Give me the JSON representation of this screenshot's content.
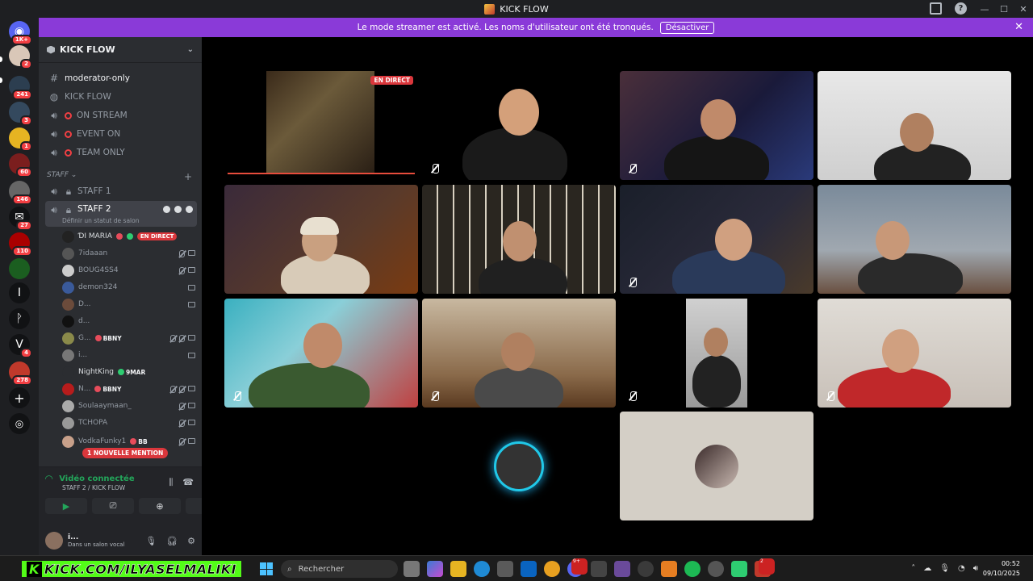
{
  "window": {
    "title": "KICK FLOW"
  },
  "banner": {
    "text": "Le mode streamer est activé. Les noms d'utilisateur ont été tronqués.",
    "button": "Désactiver"
  },
  "rail": {
    "badges": [
      "1K+",
      "2",
      "241",
      "3",
      "1",
      "60",
      "146",
      "27",
      "110",
      "4",
      "278"
    ],
    "glyphs": [
      "I",
      "ᚹ",
      "V"
    ]
  },
  "server": {
    "name": "KICK FLOW"
  },
  "channels": [
    {
      "name": "moderator-only"
    },
    {
      "name": "KICK FLOW"
    },
    {
      "name": "ON STREAM"
    },
    {
      "name": "EVENT ON"
    },
    {
      "name": "TEAM ONLY"
    }
  ],
  "category": {
    "name": "STAFF"
  },
  "voice_channels": [
    {
      "name": "STAFF 1"
    },
    {
      "name": "STAFF 2",
      "status_placeholder": "Définir un statut de salon"
    }
  ],
  "members": [
    {
      "name": "ƊI MARIA",
      "tag": "",
      "live": "EN DIRECT"
    },
    {
      "name": "7idaaan",
      "tag": ""
    },
    {
      "name": "BOUG4SS4",
      "tag": ""
    },
    {
      "name": "demon324",
      "tag": ""
    },
    {
      "name": "D...",
      "tag": ""
    },
    {
      "name": "d...",
      "tag": ""
    },
    {
      "name": "G...",
      "tag": "BBNY"
    },
    {
      "name": "i...",
      "tag": ""
    },
    {
      "name": "NightKing",
      "tag": "9MAR"
    },
    {
      "name": "N...",
      "tag": "BBNY"
    },
    {
      "name": "Soulaaymaan_",
      "tag": ""
    },
    {
      "name": "TCHOPA",
      "tag": ""
    },
    {
      "name": "VodkaFunky1",
      "tag": "BB"
    }
  ],
  "mention": "1 NOUVELLE MENTION",
  "voice": {
    "status": "Vidéo connectée",
    "location": "STAFF 2 / KICK FLOW"
  },
  "user": {
    "name": "i...",
    "status": "Dans un salon vocal"
  },
  "stage": {
    "live_label": "EN DIRECT"
  },
  "taskbar": {
    "overlay": "KICK.COM/ILYASELMALIKI",
    "overlay_logo": "K",
    "search": "Rechercher",
    "time": "00:52",
    "date": "09/10/2025",
    "discord_badge": "9+",
    "notif_badge": "2"
  },
  "colors": {
    "accent": "#8a3ad8",
    "live": "#da373c",
    "connected": "#23a55a",
    "kick": "#53fc18"
  }
}
